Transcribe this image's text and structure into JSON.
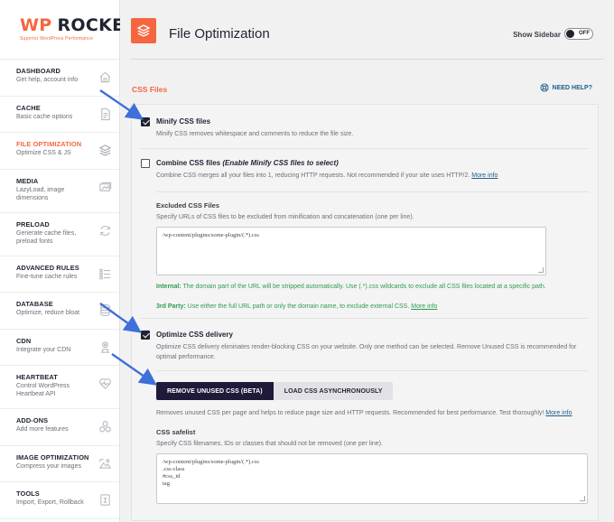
{
  "brand": {
    "name_wp": "WP",
    "name": "ROCKET",
    "tagline": "Superior WordPress Performance",
    "accent": "#f56640"
  },
  "sidebar": {
    "items": [
      {
        "title": "DASHBOARD",
        "sub": "Get help, account info",
        "icon": "home-icon"
      },
      {
        "title": "CACHE",
        "sub": "Basic cache options",
        "icon": "document-icon"
      },
      {
        "title": "FILE OPTIMIZATION",
        "sub": "Optimize CSS & JS",
        "icon": "layers-icon",
        "active": true
      },
      {
        "title": "MEDIA",
        "sub": "LazyLoad, image dimensions",
        "icon": "image-icon"
      },
      {
        "title": "PRELOAD",
        "sub": "Generate cache files, preload fonts",
        "icon": "refresh-icon"
      },
      {
        "title": "ADVANCED RULES",
        "sub": "Fine-tune cache rules",
        "icon": "list-icon"
      },
      {
        "title": "DATABASE",
        "sub": "Optimize, reduce bloat",
        "icon": "database-icon"
      },
      {
        "title": "CDN",
        "sub": "Integrate your CDN",
        "icon": "cdn-icon"
      },
      {
        "title": "HEARTBEAT",
        "sub": "Control WordPress Heartbeat API",
        "icon": "heartbeat-icon"
      },
      {
        "title": "ADD-ONS",
        "sub": "Add more features",
        "icon": "addons-icon"
      },
      {
        "title": "IMAGE OPTIMIZATION",
        "sub": "Compress your images",
        "icon": "image-optimization-icon"
      },
      {
        "title": "TOOLS",
        "sub": "Import, Export, Rollback",
        "icon": "tools-icon"
      }
    ]
  },
  "header": {
    "title": "File Optimization",
    "show_sidebar": "Show Sidebar",
    "toggle_state": "OFF"
  },
  "section": {
    "title": "CSS Files",
    "help": "NEED HELP?"
  },
  "minify": {
    "label": "Minify CSS files",
    "checked": true,
    "desc": "Minify CSS removes whitespace and comments to reduce the file size."
  },
  "combine": {
    "label": "Combine CSS files ",
    "label_em": "(Enable Minify CSS files to select)",
    "checked": false,
    "desc": "Combine CSS merges all your files into 1, reducing HTTP requests. Not recommended if your site uses HTTP/2.",
    "more_info": "More info"
  },
  "excluded": {
    "label": "Excluded CSS Files",
    "desc": "Specify URLs of CSS files to be excluded from minification and concatenation (one per line).",
    "value": "/wp-content/plugins/some-plugin/(.*).css",
    "internal_label": "Internal:",
    "internal_text": " The domain part of the URL will be stripped automatically. Use (.*).css wildcards to exclude all CSS files located at a specific path.",
    "third_label": "3rd Party:",
    "third_text": " Use either the full URL path or only the domain name, to exclude external CSS.",
    "more_info": "More info"
  },
  "optimize_delivery": {
    "label": "Optimize CSS delivery",
    "checked": true,
    "desc": "Optimize CSS delivery eliminates render-blocking CSS on your website. Only one method can be selected. Remove Unused CSS is recommended for optimal performance."
  },
  "buttons": {
    "remove_unused": "REMOVE UNUSED CSS (BETA)",
    "load_async": "LOAD CSS ASYNCHRONOUSLY"
  },
  "ruc": {
    "desc": "Removes unused CSS per page and helps to reduce page size and HTTP requests. Recommended for best performance. Test thoroughly!",
    "more_info": "More info",
    "safelist_label": "CSS safelist",
    "safelist_desc": "Specify CSS filenames, IDs or classes that should not be removed (one per line).",
    "safelist_value": "/wp-content/plugins/some-plugin/(.*).css\n.css-class\n#css_id\ntag"
  },
  "arrow_color": "#3f6fd8"
}
